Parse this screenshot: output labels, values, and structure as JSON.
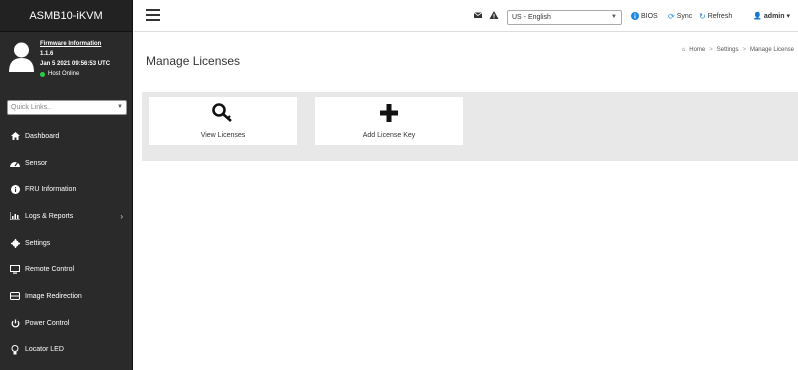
{
  "sidebar": {
    "brand": "ASMB10-iKVM",
    "user": {
      "firmware_label": "Firmware Information",
      "version": "1.1.6",
      "datetime": "Jan 5 2021 09:56:53 UTC",
      "status": "Host Online"
    },
    "quick_links": {
      "placeholder": "Quick Links.."
    },
    "items": [
      {
        "label": "Dashboard",
        "icon": "dashboard-icon"
      },
      {
        "label": "Sensor",
        "icon": "sensor-icon"
      },
      {
        "label": "FRU Information",
        "icon": "info-icon"
      },
      {
        "label": "Logs & Reports",
        "icon": "chart-icon"
      },
      {
        "label": "Settings",
        "icon": "gear-icon"
      },
      {
        "label": "Remote Control",
        "icon": "monitor-icon"
      },
      {
        "label": "Image Redirection",
        "icon": "disk-icon"
      },
      {
        "label": "Power Control",
        "icon": "power-icon"
      },
      {
        "label": "Locator LED",
        "icon": "bulb-icon"
      }
    ]
  },
  "header": {
    "language": "US - English",
    "bios": "BIOS",
    "sync": "Sync",
    "refresh": "Refresh",
    "user": "admin"
  },
  "main": {
    "title": "Manage Licenses",
    "breadcrumb": {
      "home": "Home",
      "settings": "Settings",
      "current": "Manage License"
    },
    "tiles": [
      {
        "label": "View Licenses",
        "icon": "key-icon"
      },
      {
        "label": "Add License Key",
        "icon": "plus-icon"
      }
    ]
  },
  "colors": {
    "sidebar_bg": "#2a2a2a",
    "online_dot": "#2ecc40",
    "link_blue": "#1e88e5",
    "panel_bg": "#e8e8e8"
  }
}
